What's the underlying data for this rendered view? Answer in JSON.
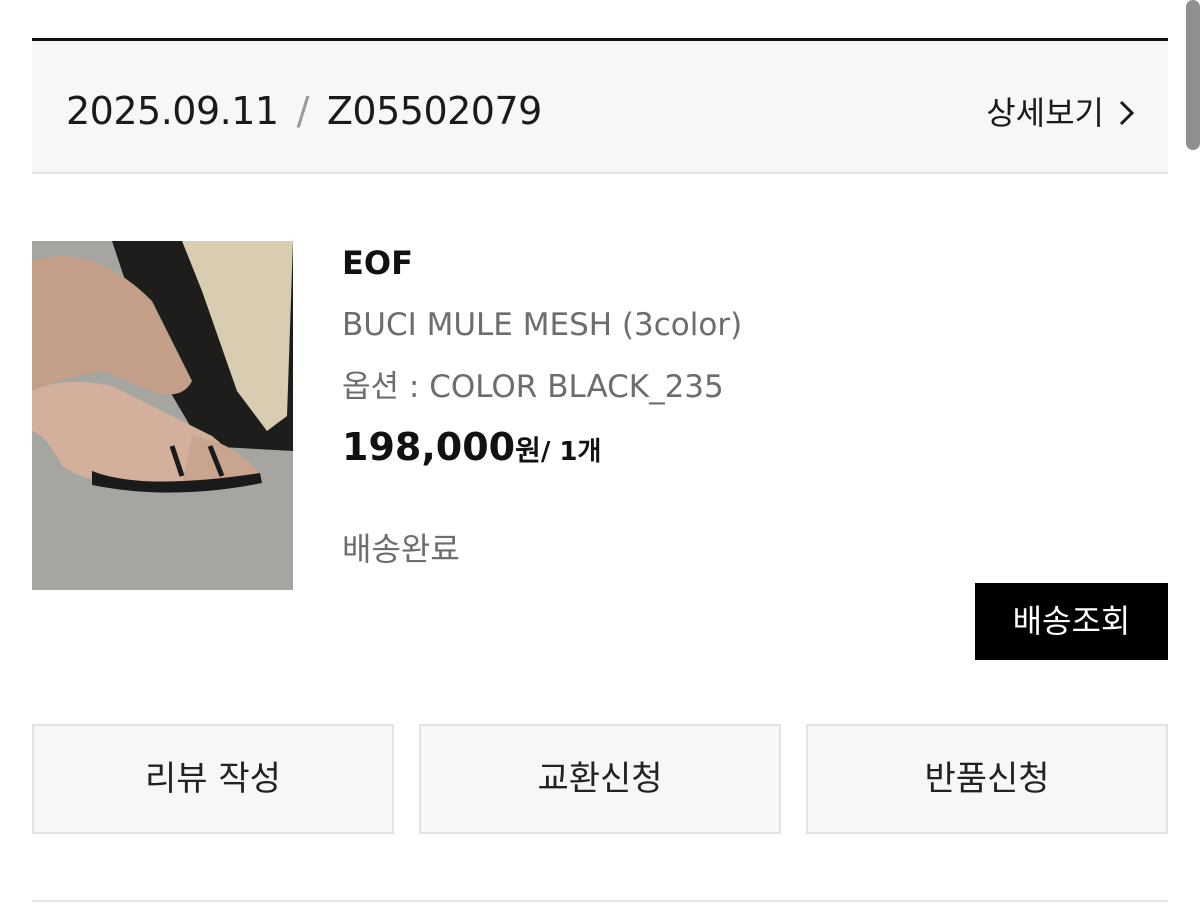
{
  "order": {
    "date": "2025.09.11",
    "separator": "/",
    "number": "Z05502079",
    "detail_label": "상세보기"
  },
  "product": {
    "image_icon": "product-photo-sandal",
    "brand": "EOF",
    "name": "BUCI MULE MESH (3color)",
    "option": "옵션 : COLOR BLACK_235",
    "price": "198,000",
    "price_unit": "원",
    "quantity": "/ 1개",
    "status": "배송완료"
  },
  "buttons": {
    "track": "배송조회",
    "review": "리뷰 작성",
    "exchange": "교환신청",
    "return": "반품신청"
  },
  "colors": {
    "header_bg": "#f7f7f7",
    "primary_button": "#000000",
    "muted_text": "#6d6d6d"
  }
}
